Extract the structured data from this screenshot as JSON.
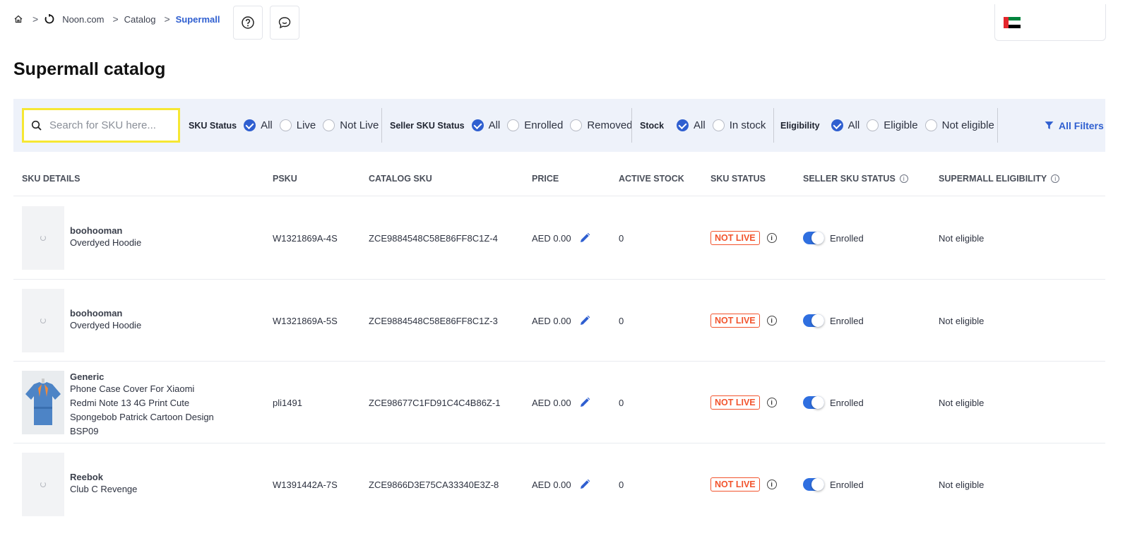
{
  "breadcrumb": {
    "items": [
      {
        "label": "Noon.com"
      },
      {
        "label": "Catalog"
      },
      {
        "label": "Supermall"
      }
    ]
  },
  "page": {
    "title": "Supermall catalog"
  },
  "search": {
    "placeholder": "Search for SKU here..."
  },
  "filters": {
    "sku_status": {
      "label": "SKU Status",
      "options": [
        "All",
        "Live",
        "Not Live"
      ],
      "selected": "All"
    },
    "seller_sku_status": {
      "label": "Seller SKU Status",
      "options": [
        "All",
        "Enrolled",
        "Removed"
      ],
      "selected": "All"
    },
    "stock": {
      "label": "Stock",
      "options": [
        "All",
        "In stock"
      ],
      "selected": "All"
    },
    "eligibility": {
      "label": "Eligibility",
      "options": [
        "All",
        "Eligible",
        "Not eligible"
      ],
      "selected": "All"
    },
    "all_filters_label": "All Filters"
  },
  "table": {
    "columns": [
      "SKU DETAILS",
      "PSKU",
      "CATALOG SKU",
      "PRICE",
      "ACTIVE STOCK",
      "SKU STATUS",
      "SELLER SKU STATUS",
      "SUPERMALL ELIGIBILITY"
    ],
    "rows": [
      {
        "brand": "boohooman",
        "name": "Overdyed Hoodie",
        "psku": "W1321869A-4S",
        "catalog_sku": "ZCE9884548C58E86FF8C1Z-4",
        "price": "AED 0.00",
        "stock": "0",
        "sku_status": "NOT LIVE",
        "seller_status": "Enrolled",
        "eligibility": "Not eligible"
      },
      {
        "brand": "boohooman",
        "name": "Overdyed Hoodie",
        "psku": "W1321869A-5S",
        "catalog_sku": "ZCE9884548C58E86FF8C1Z-3",
        "price": "AED 0.00",
        "stock": "0",
        "sku_status": "NOT LIVE",
        "seller_status": "Enrolled",
        "eligibility": "Not eligible"
      },
      {
        "brand": "Generic",
        "name": "Phone Case Cover For Xiaomi Redmi Note 13 4G Print Cute Spongebob Patrick Cartoon Design BSP09",
        "psku": "pli1491",
        "catalog_sku": "ZCE98677C1FD91C4C4B86Z-1",
        "price": "AED 0.00",
        "stock": "0",
        "sku_status": "NOT LIVE",
        "seller_status": "Enrolled",
        "eligibility": "Not eligible"
      },
      {
        "brand": "Reebok",
        "name": "Club C Revenge",
        "psku": "W1391442A-7S",
        "catalog_sku": "ZCE9866D3E75CA33340E3Z-8",
        "price": "AED 0.00",
        "stock": "0",
        "sku_status": "NOT LIVE",
        "seller_status": "Enrolled",
        "eligibility": "Not eligible"
      }
    ]
  },
  "colors": {
    "accent": "#2f5fd0",
    "status_not_live": "#f2542d",
    "filter_bg": "#eef2fa",
    "search_highlight": "#f6e733"
  },
  "icons": [
    "home-icon",
    "chevron-right-icon",
    "spinner-icon",
    "help-icon",
    "chat-icon",
    "uae-flag-icon",
    "search-icon",
    "check-circle-icon",
    "radio-icon",
    "filter-icon",
    "info-icon",
    "pencil-icon",
    "toggle-icon"
  ]
}
